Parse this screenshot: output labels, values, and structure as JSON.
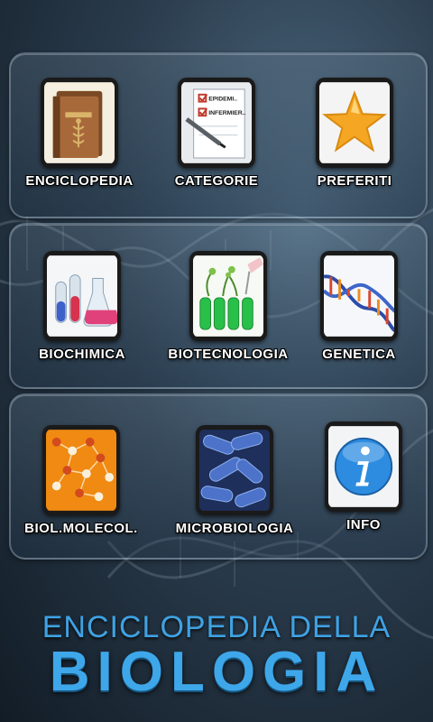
{
  "menu": {
    "items": [
      {
        "label": "ENCICLOPEDIA",
        "icon": "books-icon"
      },
      {
        "label": "CATEGORIE",
        "icon": "checklist-icon"
      },
      {
        "label": "PREFERITI",
        "icon": "star-icon"
      },
      {
        "label": "BIOCHIMICA",
        "icon": "flasks-icon"
      },
      {
        "label": "BIOTECNOLOGIA",
        "icon": "test-tubes-icon"
      },
      {
        "label": "GENETICA",
        "icon": "dna-icon"
      },
      {
        "label": "BIOL.MOLECOL.",
        "icon": "molecule-icon"
      },
      {
        "label": "MICROBIOLOGIA",
        "icon": "bacteria-icon"
      },
      {
        "label": "INFO",
        "icon": "info-icon"
      }
    ]
  },
  "checklist": {
    "line1": "EPIDEMI..",
    "line2": "INFERMIER.."
  },
  "title": {
    "line1": "ENCICLOPEDIA DELLA",
    "line2": "BIOLOGIA"
  }
}
